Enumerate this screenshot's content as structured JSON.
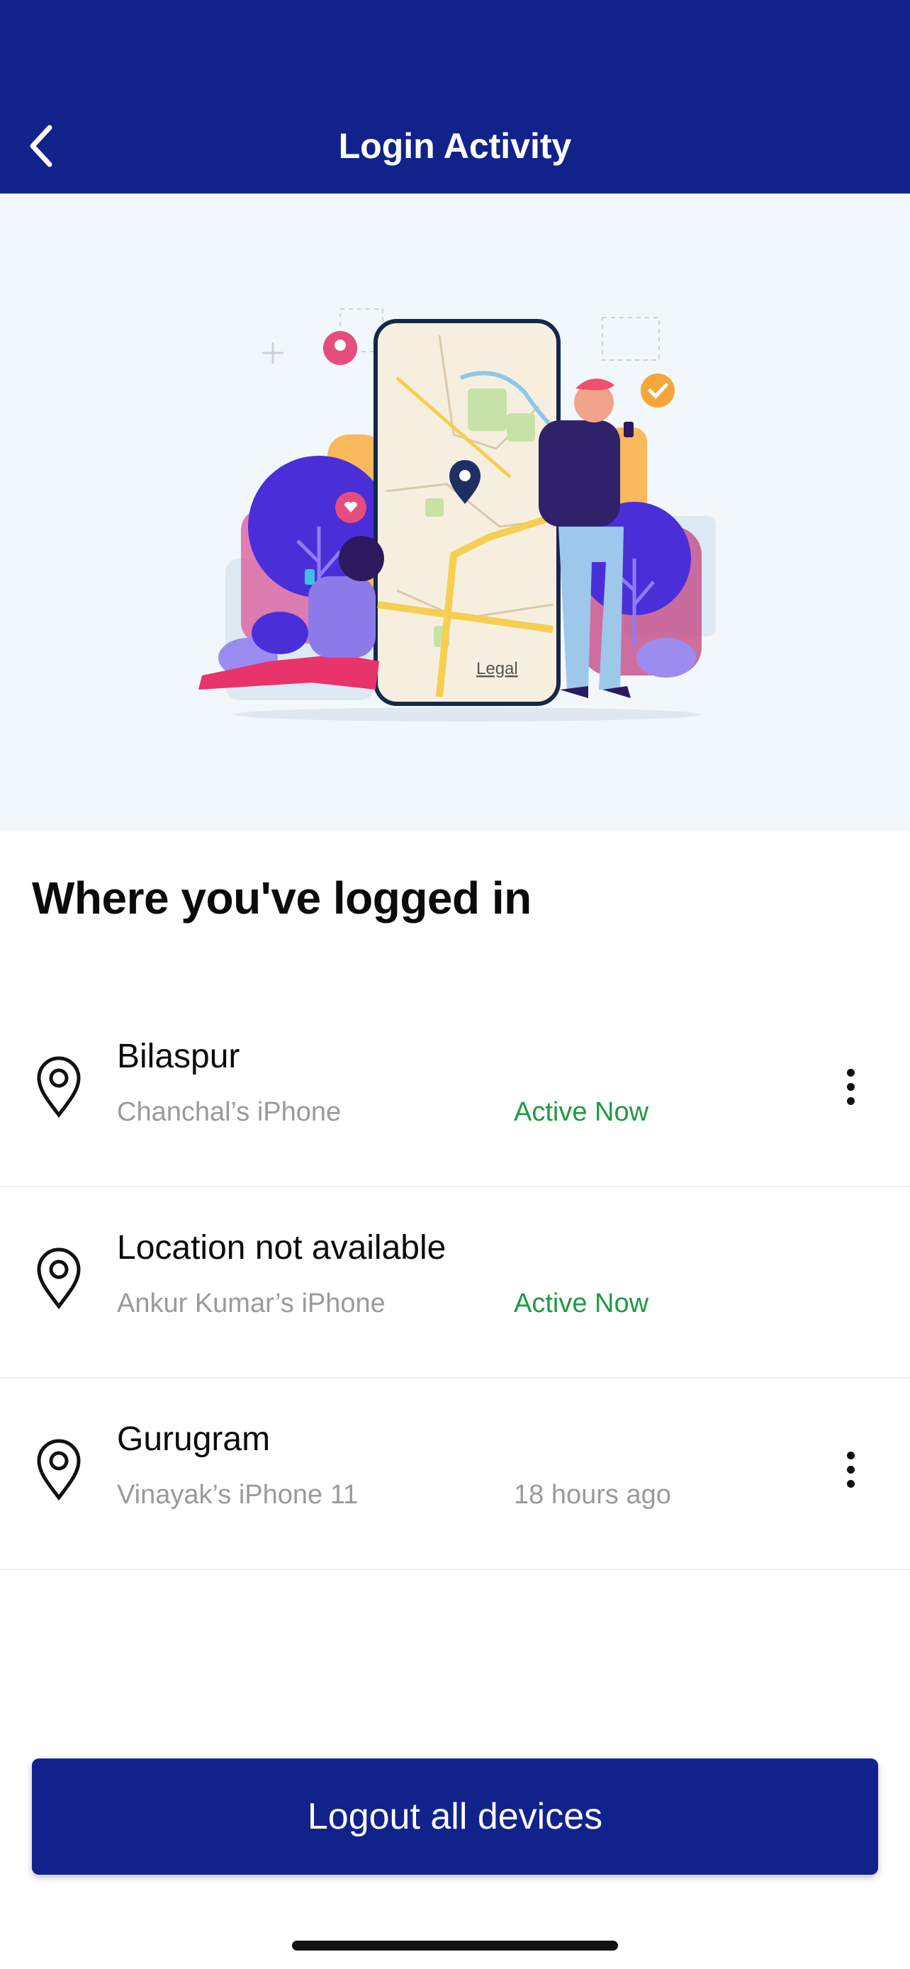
{
  "header": {
    "title": "Login Activity",
    "back_icon": "chevron-left-icon"
  },
  "hero": {
    "map_label": "Legal"
  },
  "section": {
    "title": "Where you've logged in"
  },
  "sessions": [
    {
      "location": "Bilaspur",
      "device": "Chanchal’s iPhone",
      "status": "Active Now",
      "status_type": "active",
      "has_menu": true
    },
    {
      "location": "Location not available",
      "device": "Ankur Kumar’s iPhone",
      "status": "Active Now",
      "status_type": "active",
      "has_menu": false
    },
    {
      "location": "Gurugram",
      "device": "Vinayak’s iPhone 11",
      "status": "18 hours ago",
      "status_type": "past",
      "has_menu": true
    }
  ],
  "actions": {
    "logout_label": "Logout all devices"
  },
  "colors": {
    "primary": "#11238a",
    "active_status": "#1e9a42",
    "muted_text": "#9a9a9a",
    "hero_background": "#f1f7fb"
  }
}
